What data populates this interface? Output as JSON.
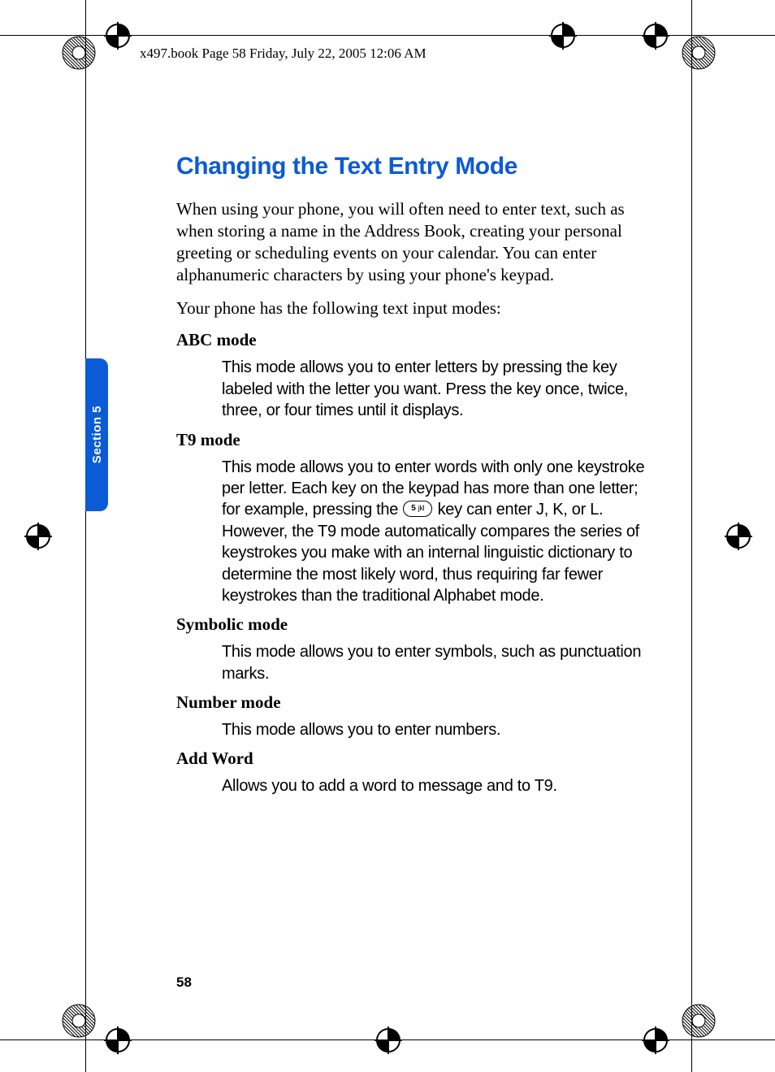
{
  "prepress_header": "x497.book  Page 58  Friday, July 22, 2005  12:06 AM",
  "side_tab_label": "Section 5",
  "page_number": "58",
  "title": "Changing the Text Entry Mode",
  "intro_para_1": "When using your phone, you will often need to enter text, such as when storing a name in the Address Book, creating your personal greeting or scheduling events on your calendar. You can enter alphanumeric characters by using your phone's keypad.",
  "intro_para_2": "Your phone has the following text input modes:",
  "key_icon_label": "5 jkl",
  "modes": {
    "abc": {
      "head": "ABC mode",
      "body": "This mode allows you to enter letters by pressing the key labeled with the letter you want. Press the key once, twice, three, or four times until it displays."
    },
    "t9": {
      "head": "T9 mode",
      "body_before": "This mode allows you to enter words with only one keystroke per letter. Each key on the keypad has more than one letter; for example, pressing the",
      "body_after": "key can enter J, K, or L. However, the T9 mode automatically compares the series of keystrokes you make with an internal linguistic dictionary to determine the most likely word, thus requiring far fewer keystrokes than the traditional Alphabet mode."
    },
    "symbolic": {
      "head": "Symbolic mode",
      "body": "This mode allows you to enter symbols, such as punctuation marks."
    },
    "number": {
      "head": "Number mode",
      "body": "This mode allows you to enter numbers."
    },
    "addword": {
      "head": "Add Word",
      "body": "Allows you to add a word to message and to T9."
    }
  }
}
